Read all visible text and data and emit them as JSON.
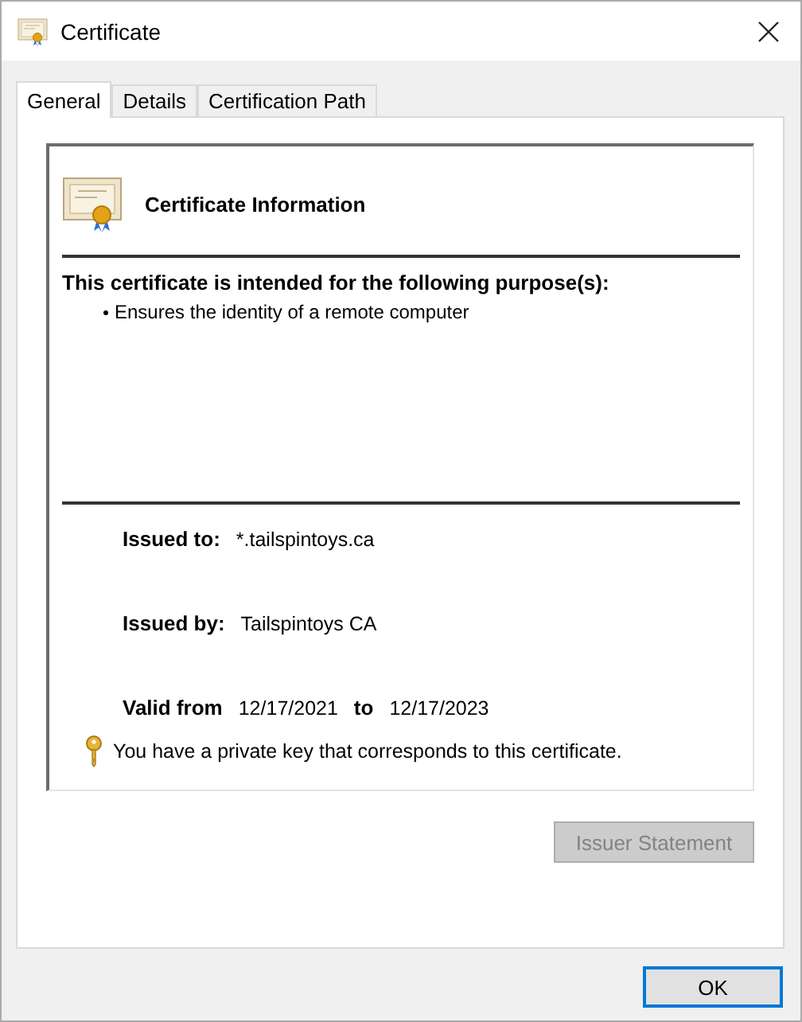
{
  "window": {
    "title": "Certificate"
  },
  "tabs": [
    {
      "label": "General",
      "selected": true
    },
    {
      "label": "Details",
      "selected": false
    },
    {
      "label": "Certification Path",
      "selected": false
    }
  ],
  "certificate_info": {
    "heading": "Certificate Information",
    "purpose_heading": "This certificate is intended for the following purpose(s):",
    "purposes": [
      "Ensures the identity of a remote computer"
    ],
    "fields": [
      {
        "label": "Issued to:",
        "value": "*.tailspintoys.ca"
      },
      {
        "label": "Issued by:",
        "value": "Tailspintoys CA"
      }
    ],
    "validity": {
      "label": "Valid from",
      "from": "12/17/2021",
      "separator": "to",
      "to": "12/17/2023"
    },
    "private_key_note": "You have a private key that corresponds to this certificate."
  },
  "issuer_statement_button": {
    "label": "Issuer Statement",
    "disabled": true
  },
  "buttons": [
    {
      "label": "OK",
      "default": true
    }
  ]
}
